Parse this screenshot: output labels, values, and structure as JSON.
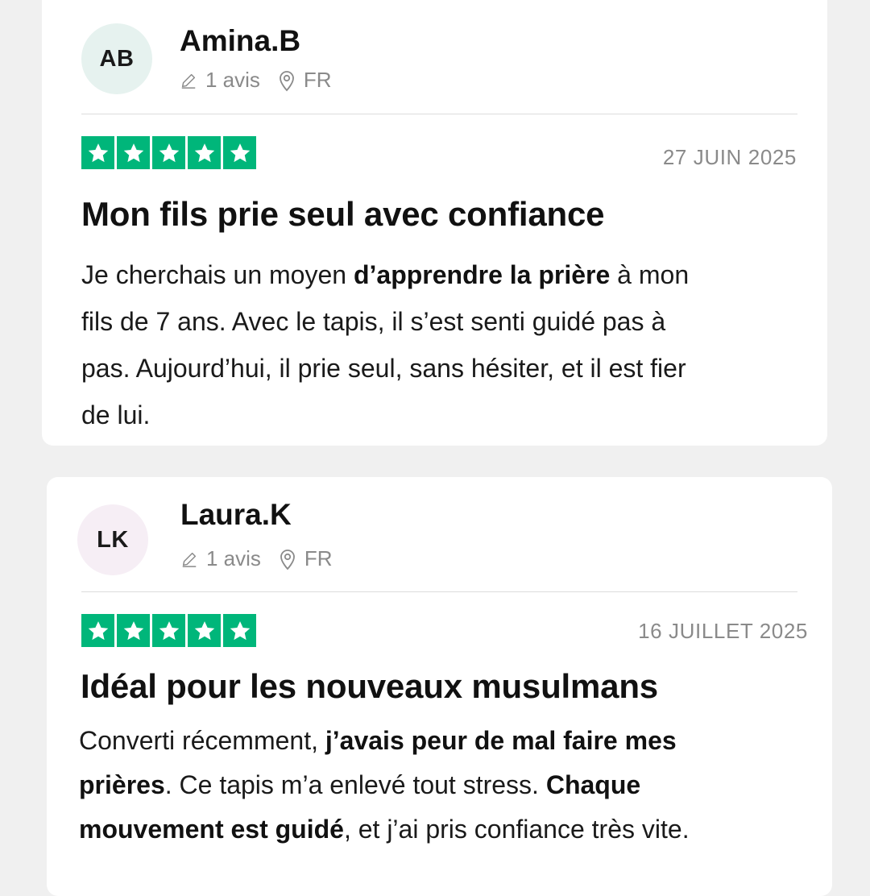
{
  "reviews": [
    {
      "initials": "AB",
      "name": "Amina.B",
      "review_count": "1 avis",
      "country": "FR",
      "rating": 5,
      "date": "27 JUIN 2025",
      "title": "Mon fils prie seul avec confiance",
      "avatar_color": "#e6f2ef",
      "body": [
        {
          "t": "Je cherchais un moyen ",
          "b": false
        },
        {
          "t": "d’apprendre la prière",
          "b": true
        },
        {
          "t": " à mon",
          "b": false
        },
        {
          "t": "fils de 7 ans. Avec le tapis, il s’est senti guidé pas à",
          "b": false
        },
        {
          "t": "pas. Aujourd’hui, il prie seul, sans hésiter, et il est fier",
          "b": false
        },
        {
          "t": "de lui.",
          "b": false
        }
      ]
    },
    {
      "initials": "LK",
      "name": "Laura.K",
      "review_count": "1 avis",
      "country": "FR",
      "rating": 5,
      "date": "16 JUILLET 2025",
      "title": "Idéal pour les nouveaux musulmans",
      "avatar_color": "#f6eef5",
      "body": [
        {
          "t": "Converti récemment, ",
          "b": false
        },
        {
          "t": "j’avais peur de mal faire mes",
          "b": true
        },
        {
          "t": "prières",
          "b": true
        },
        {
          "t": ". Ce tapis m’a enlevé tout stress. ",
          "b": false
        },
        {
          "t": "Chaque",
          "b": true
        },
        {
          "t": "mouvement est guidé",
          "b": true
        },
        {
          "t": ", et j’ai pris confiance très vite.",
          "b": false
        }
      ]
    }
  ],
  "colors": {
    "star_green": "#00b67a",
    "meta_gray": "#8a8a8a"
  },
  "icons": {
    "review_count": "pencil-icon",
    "location": "location-pin-icon",
    "star": "star-icon"
  }
}
